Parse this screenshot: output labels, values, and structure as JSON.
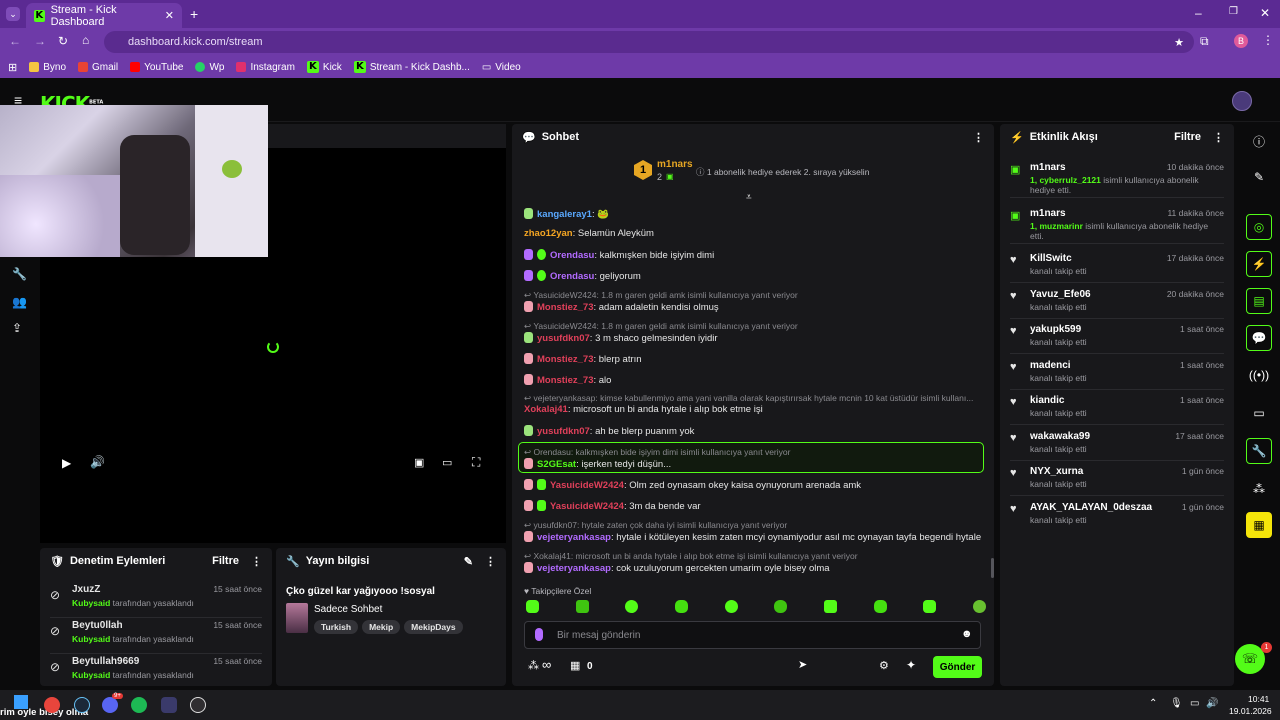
{
  "browser": {
    "tab_title": "Stream - Kick Dashboard",
    "url": "dashboard.kick.com/stream",
    "profile_initial": "B",
    "bookmarks": [
      "Byno",
      "Gmail",
      "YouTube",
      "Wp",
      "Instagram",
      "Kick",
      "Stream - Kick Dashb...",
      "Video"
    ]
  },
  "brand": {
    "logo": "KICK",
    "beta": "BETA",
    "accent": "#53fc18"
  },
  "chat": {
    "title": "Sohbet",
    "top_user": "m1nars",
    "top_rank": "1",
    "top_count": "2",
    "top_hint": "1 abonelik hediye ederek 2. sıraya yükselin",
    "messages": [
      {
        "reply": "",
        "user": "kangaleray1",
        "color": "#5aa9ff",
        "text": ": 🐸"
      },
      {
        "reply": "",
        "user": "zhao12yan",
        "color": "#f5a623",
        "text": ": Selamün Aleyküm"
      },
      {
        "reply": "",
        "user": "Orendasu",
        "color": "#b26bff",
        "text": ": kalkmışken bide işiyim dimi"
      },
      {
        "reply": "",
        "user": "Orendasu",
        "color": "#b26bff",
        "text": ": geliyorum"
      },
      {
        "reply": "YasuicideW2424: 1.8 m garen geldi amk isimli kullanıcıya yanıt veriyor",
        "user": "Monstiez_73",
        "color": "#e0405a",
        "text": ": adam adaletin kendisi olmuş"
      },
      {
        "reply": "YasuicideW2424: 1.8 m garen geldi amk isimli kullanıcıya yanıt veriyor",
        "user": "yusufdkn07",
        "color": "#e0405a",
        "text": ": 3 m shaco gelmesinden iyidir"
      },
      {
        "reply": "",
        "user": "Monstiez_73",
        "color": "#e0405a",
        "text": ": blerp atrın"
      },
      {
        "reply": "",
        "user": "Monstiez_73",
        "color": "#e0405a",
        "text": ": alo"
      },
      {
        "reply": "vejeteryankasap: kimse kabullenmiyo ama yani vanilla olarak kapıştırırsak hytale mcnin 10 kat üstüdür isimli kullanı...",
        "user": "Xokalaj41",
        "color": "#e0405a",
        "text": ": microsoft un bi anda hytale i alıp bok etme işi"
      },
      {
        "reply": "",
        "user": "yusufdkn07",
        "color": "#e0405a",
        "text": ": ah be blerp puanım yok"
      },
      {
        "reply": "Orendasu: kalkmışken bide işiyim dimi isimli kullanıcıya yanıt veriyor",
        "user": "S2GEsat",
        "color": "#53fc18",
        "text": ": işerken tedyi düşün..."
      },
      {
        "reply": "",
        "user": "YasuicideW2424",
        "color": "#e0405a",
        "text": ": Olm zed oynasam okey kaisa oynuyorum arenada amk"
      },
      {
        "reply": "",
        "user": "YasuicideW2424",
        "color": "#e0405a",
        "text": ": 3m da bende var"
      },
      {
        "reply": "yusufdkn07: hytale zaten çok daha iyi isimli kullanıcıya yanıt veriyor",
        "user": "vejeteryankasap",
        "color": "#b26bff",
        "text": ": hytale i kötüleyen kesim zaten mcyi oynamiyodur asıl mc oynayan tayfa begendi hytale i"
      },
      {
        "reply": "Xokalaj41: microsoft un bi anda hytale i alıp bok etme işi isimli kullanıcıya yanıt veriyor",
        "user": "vejeteryankasap",
        "color": "#b26bff",
        "text": ": cok uzuluyorum gercekten umarim oyle bisey olma"
      }
    ],
    "followers_only": "Takipçilere Özel",
    "input_placeholder": "Bir mesaj gönderin",
    "points": "0",
    "infinity": "∞",
    "send_label": "Gönder"
  },
  "activity": {
    "title": "Etkinlik Akışı",
    "filter": "Filtre",
    "items": [
      {
        "name": "m1nars",
        "time": "10 dakika önce",
        "highlight": "1, cyberrulz_2121",
        "desc": " isimli kullanıcıya abonelik hediye etti.",
        "icon": "gift"
      },
      {
        "name": "m1nars",
        "time": "11 dakika önce",
        "highlight": "1, muzmarinr",
        "desc": " isimli kullanıcıya abonelik hediye etti.",
        "icon": "gift"
      },
      {
        "name": "KillSwitc",
        "time": "17 dakika önce",
        "highlight": "",
        "desc": "kanalı takip etti",
        "icon": "heart"
      },
      {
        "name": "Yavuz_Efe06",
        "time": "20 dakika önce",
        "highlight": "",
        "desc": "kanalı takip etti",
        "icon": "heart"
      },
      {
        "name": "yakupk599",
        "time": "1 saat önce",
        "highlight": "",
        "desc": "kanalı takip etti",
        "icon": "heart"
      },
      {
        "name": "madenci",
        "time": "1 saat önce",
        "highlight": "",
        "desc": "kanalı takip etti",
        "icon": "heart"
      },
      {
        "name": "kiandic",
        "time": "1 saat önce",
        "highlight": "",
        "desc": "kanalı takip etti",
        "icon": "heart"
      },
      {
        "name": "wakawaka99",
        "time": "17 saat önce",
        "highlight": "",
        "desc": "kanalı takip etti",
        "icon": "heart"
      },
      {
        "name": "NYX_xurna",
        "time": "1 gün önce",
        "highlight": "",
        "desc": "kanalı takip etti",
        "icon": "heart"
      },
      {
        "name": "AYAK_YALAYAN_0deszaa",
        "time": "1 gün önce",
        "highlight": "",
        "desc": "kanalı takip etti",
        "icon": "heart"
      }
    ]
  },
  "moderation": {
    "title": "Denetim Eylemleri",
    "filter": "Filtre",
    "items": [
      {
        "name": "JxuzZ",
        "time": "15 saat önce",
        "by": "Kubysaid",
        "action": " tarafından yasaklandı"
      },
      {
        "name": "Beytu0llah",
        "time": "15 saat önce",
        "by": "Kubysaid",
        "action": " tarafından yasaklandı"
      },
      {
        "name": "Beytullah9669",
        "time": "15 saat önce",
        "by": "Kubysaid",
        "action": " tarafından yasaklandı"
      }
    ]
  },
  "stream_info": {
    "title": "Yayın bilgisi",
    "stream_title": "Çko güzel kar yağıyooo !sosyal",
    "category": "Sadece Sohbet",
    "tags": [
      "Turkish",
      "Mekip",
      "MekipDays"
    ]
  },
  "taskbar": {
    "left_text": "rim oyle bisey olma",
    "time": "10:41",
    "date": "19.01.2026",
    "discord_badge": "9+"
  },
  "support_badge": "1"
}
